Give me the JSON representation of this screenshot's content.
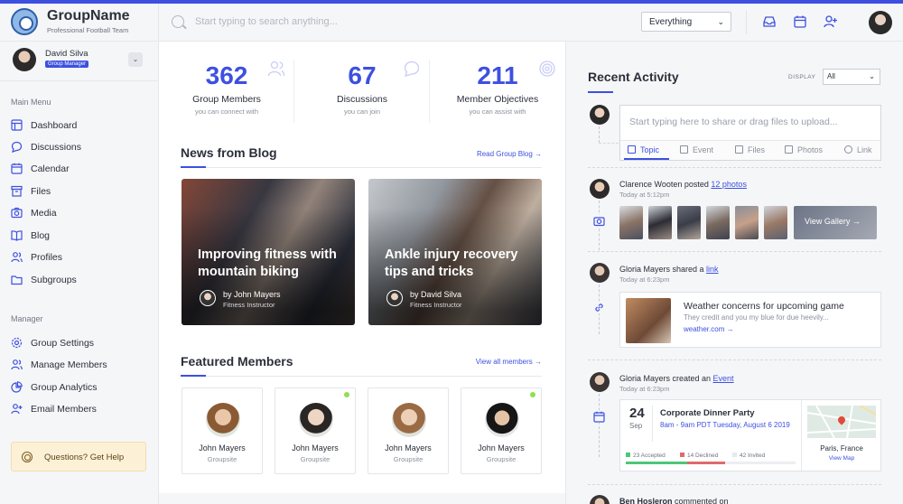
{
  "brand": {
    "name": "GroupName",
    "subtitle": "Professional Football Team"
  },
  "search": {
    "placeholder": "Start typing to search anything...",
    "scope": "Everything"
  },
  "topbar": {
    "icons": [
      "inbox-icon",
      "calendar-icon",
      "add-user-icon"
    ]
  },
  "user": {
    "name": "David Silva",
    "role": "Group Manager"
  },
  "nav": {
    "main_heading": "Main Menu",
    "main_items": [
      {
        "label": "Dashboard",
        "icon": "dashboard-icon"
      },
      {
        "label": "Discussions",
        "icon": "chat-icon"
      },
      {
        "label": "Calendar",
        "icon": "calendar-icon"
      },
      {
        "label": "Files",
        "icon": "files-icon"
      },
      {
        "label": "Media",
        "icon": "camera-icon"
      },
      {
        "label": "Blog",
        "icon": "book-icon"
      },
      {
        "label": "Profiles",
        "icon": "users-icon"
      },
      {
        "label": "Subgroups",
        "icon": "folder-icon"
      }
    ],
    "manager_heading": "Manager",
    "manager_items": [
      {
        "label": "Group Settings",
        "icon": "gear-icon"
      },
      {
        "label": "Manage Members",
        "icon": "users-icon"
      },
      {
        "label": "Group Analytics",
        "icon": "pie-chart-icon"
      },
      {
        "label": "Email Members",
        "icon": "add-user-icon"
      }
    ],
    "help_label": "Questions? Get Help"
  },
  "stats": [
    {
      "value": "362",
      "label": "Group Members",
      "sub": "you can connect with"
    },
    {
      "value": "67",
      "label": "Discussions",
      "sub": "you can join"
    },
    {
      "value": "211",
      "label": "Member Objectives",
      "sub": "you can assist with"
    }
  ],
  "blog": {
    "title": "News from Blog",
    "link": "Read Group Blog →",
    "posts": [
      {
        "title": "Improving fitness with mountain biking",
        "author": "by John Mayers",
        "role": "Fitness Instructor"
      },
      {
        "title": "Ankle injury recovery tips and tricks",
        "author": "by David Silva",
        "role": "Fitness Instructor"
      }
    ]
  },
  "members": {
    "title": "Featured Members",
    "link": "View all members →",
    "items": [
      {
        "name": "John Mayers",
        "role": "Groupsite",
        "online": false
      },
      {
        "name": "John Mayers",
        "role": "Groupsite",
        "online": true
      },
      {
        "name": "John Mayers",
        "role": "Groupsite",
        "online": false
      },
      {
        "name": "John Mayers",
        "role": "Groupsite",
        "online": true
      }
    ]
  },
  "activity": {
    "title": "Recent Activity",
    "display_label": "DISPLAY",
    "display_value": "All",
    "composer_placeholder": "Start typing here to share or drag files to upload...",
    "composer_tabs": [
      "Topic",
      "Event",
      "Files",
      "Photos",
      "Link"
    ],
    "items": [
      {
        "user": "Clarence Wooten",
        "action": " posted ",
        "link": "12 photos",
        "time": "Today at 5:12pm"
      },
      {
        "user": "Gloria Mayers",
        "action": " shared a ",
        "link": "link",
        "time": "Today at 6:23pm"
      },
      {
        "user": "Gloria Mayers",
        "action": " created an ",
        "link": "Event",
        "time": "Today at 6:23pm"
      }
    ],
    "gallery_label": "View Gallery →",
    "shared_link": {
      "title": "Weather concerns for upcoming game",
      "desc": "They credit and you my blue for due heevily...",
      "url": "weather.com  →"
    },
    "event": {
      "day": "24",
      "month": "Sep",
      "name": "Corporate Dinner Party",
      "time": "8am - 9am PDT Tuesday, August 6 2019",
      "accepted": "23 Accepted",
      "declined": "14 Declined",
      "invited": "42 Invited",
      "accepted_count": 23,
      "declined_count": 14,
      "invited_count": 42,
      "location": "Paris, France",
      "map_link": "View Map"
    },
    "next_user": "Ben Hosleron",
    "next_action": " commented on"
  },
  "colors": {
    "accent": "#3d50e0",
    "online": "#8ee04f",
    "help_bg": "#fcf0d7"
  }
}
